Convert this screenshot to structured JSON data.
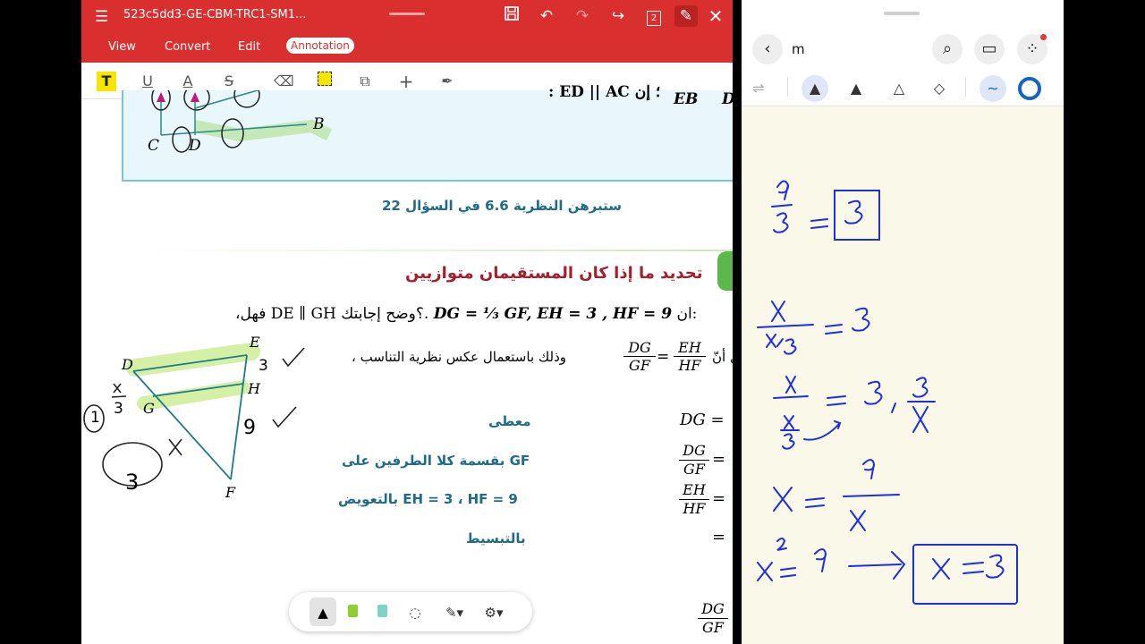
{
  "left_app": {
    "doc_title": "523c5dd3-GE-CBM-TRC1-SM1...",
    "toolbar_icons": [
      "menu-icon",
      "save-icon",
      "undo-icon",
      "redo-icon",
      "share-icon",
      "page-count-icon",
      "pen-edit-icon",
      "close-icon"
    ],
    "page_count": "2",
    "menu": [
      "View",
      "Convert",
      "Edit",
      "Annotation"
    ],
    "active_menu": "Annotation",
    "annotation_tools": [
      "highlight-text-icon",
      "underline-icon",
      "text-color-icon",
      "strikethrough-icon",
      "eraser-icon",
      "area-highlight-icon",
      "shapes-icon",
      "add-icon",
      "signature-icon"
    ],
    "figure_top": {
      "labels": [
        "C",
        "D",
        "B"
      ],
      "equation_fragment": ": ED || AC  ؛ إن",
      "fraction_bottoms": [
        "EB",
        "D"
      ]
    },
    "caption": "ستبرهن النظرية 6.6 في السؤال 22",
    "section_heading": "تحديد ما إذا كان المستقيمان متوازيين",
    "problem": {
      "prefix": "ان:",
      "givens": "DG = ⅓ GF, EH = 3 , HF = 9",
      "question": "،فهل  DE ∥ GH ؟وضح إجابتك.",
      "line2_text": "، وذلك باستعمال عكس نظرية التناسب",
      "line2_prefix": "ل أنّ",
      "ratio_left_num": "DG",
      "ratio_left_den": "GF",
      "ratio_right_num": "EH",
      "ratio_right_den": "HF"
    },
    "triangle_labels": [
      "D",
      "E",
      "G",
      "H",
      "F"
    ],
    "handwritten_left": [
      "x",
      "3",
      "3",
      "1",
      "3",
      "9"
    ],
    "steps": [
      {
        "reason": "معطى",
        "expr": "DG ="
      },
      {
        "reason": "بقسمة كلا الطرفين على GF",
        "expr_num": "DG",
        "expr_den": "GF"
      },
      {
        "reason": "بالتعويض EH = 3 ، HF = 9",
        "expr_num": "EH",
        "expr_den": "HF"
      },
      {
        "reason": "بالتبسيط",
        "expr": "="
      }
    ],
    "bottom_fraction": {
      "num": "DG",
      "den": "GF"
    }
  },
  "floating_toolbar": [
    "black-pen-icon",
    "green-highlighter-icon",
    "teal-highlighter-icon",
    "lasso-icon",
    "pen-options-icon",
    "settings-icon"
  ],
  "right_app": {
    "note_title": "m",
    "header_icons": [
      "back-icon",
      "search-icon",
      "reading-mode-icon",
      "more-icon"
    ],
    "pen_tools": [
      "redo-stroke-icon",
      "fine-pen-icon",
      "marker-icon",
      "highlighter-icon",
      "eraser-icon",
      "stroke-style-icon",
      "color-picker-icon"
    ],
    "accent": "#1565c0",
    "handwriting": [
      "9/3 = [3]",
      "x/(x/3) = 3",
      "x/(x/3) = 3 , 3/x",
      "x = 9/x",
      "x² = 9 → [x = 3]"
    ]
  },
  "colors": {
    "topbar": "#d9302f",
    "teal": "#1e6b8c",
    "maroon": "#a81d2c",
    "ink": "#1e2ee0",
    "highlight": "#c9ec8e"
  }
}
